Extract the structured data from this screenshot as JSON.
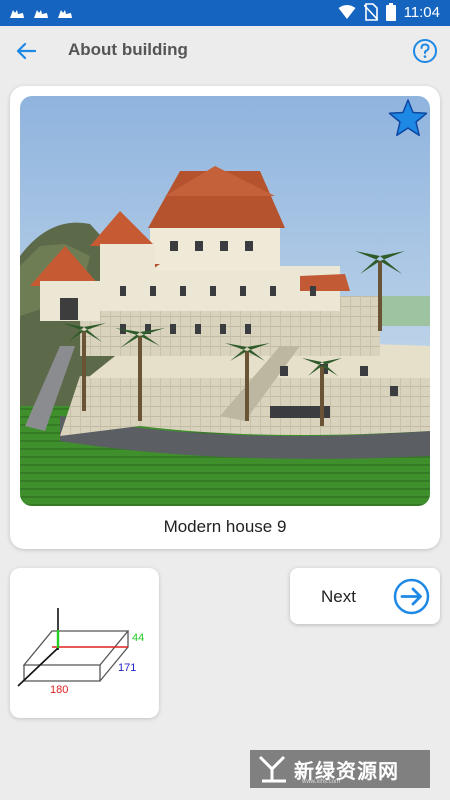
{
  "status_bar": {
    "time": "11:04",
    "left_icons": [
      "cat-notification-icon",
      "cat-notification-icon",
      "cat-notification-icon"
    ],
    "right_icons": [
      "wifi-icon",
      "no-sim-icon",
      "battery-icon"
    ]
  },
  "app_bar": {
    "title": "About building",
    "back_icon": "arrow-back-icon",
    "help_icon": "help-circle-icon"
  },
  "building": {
    "name": "Modern house 9",
    "favorite": true
  },
  "dimensions": {
    "height": "44",
    "depth": "171",
    "width": "180",
    "colors": {
      "height": "#22cc22",
      "depth": "#2222cc",
      "width": "#dd2222"
    }
  },
  "next_button": {
    "label": "Next",
    "icon": "arrow-right-circle-icon"
  },
  "watermark": {
    "text": "新绿资源网",
    "url": "www.xlhs.com"
  },
  "colors": {
    "status_bar": "#1565c0",
    "accent": "#1e88e5",
    "background": "#ececec"
  }
}
